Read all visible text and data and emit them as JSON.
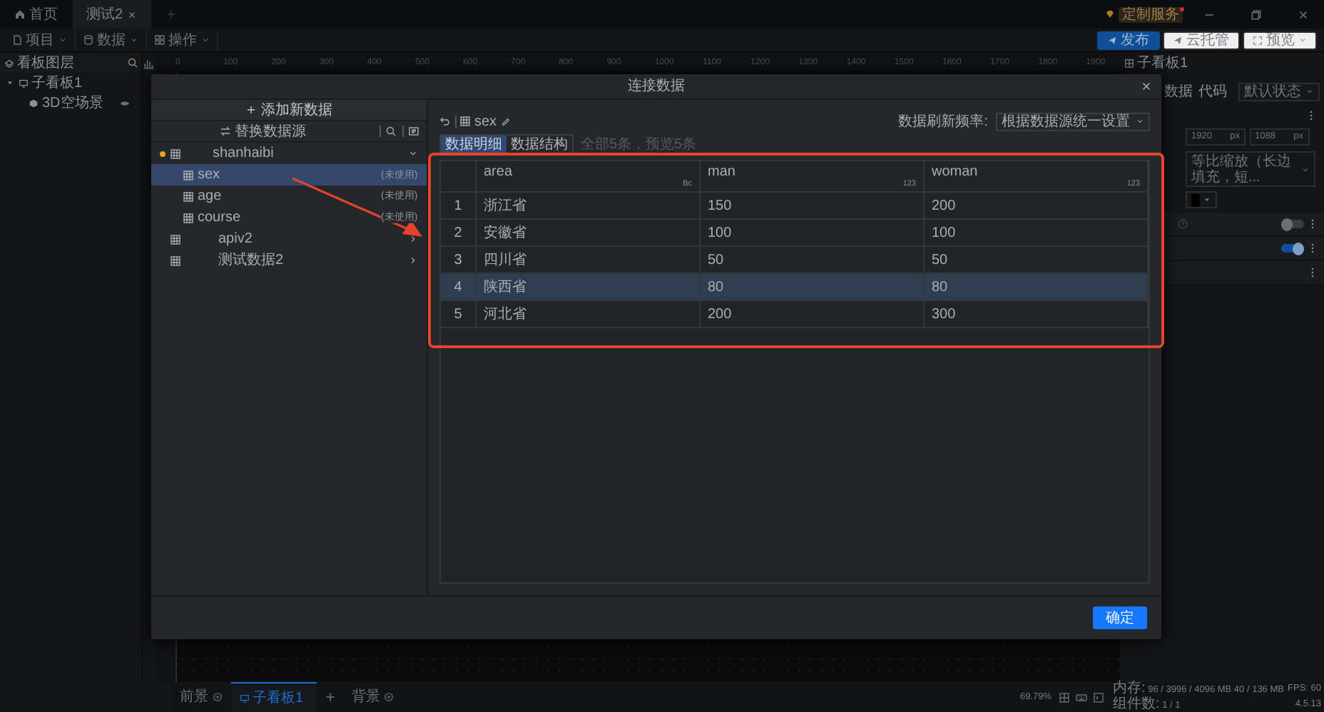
{
  "app_tabs": [
    {
      "label": "首页",
      "kind": "home",
      "selected": false,
      "closable": false
    },
    {
      "label": "测试2",
      "kind": "file",
      "selected": true,
      "closable": true
    }
  ],
  "service_badge": "定制服务",
  "menus": [
    {
      "label": "项目",
      "kind": "file"
    },
    {
      "label": "数据",
      "kind": "database"
    },
    {
      "label": "操作",
      "kind": "grid"
    }
  ],
  "actions": [
    {
      "label": "发布",
      "kind": "primary"
    },
    {
      "label": "云托管",
      "kind": "plain"
    },
    {
      "label": "预览",
      "kind": "dropdown"
    }
  ],
  "layers_panel": {
    "title": "看板图层",
    "tree": [
      {
        "label": "子看板1",
        "kind": "board",
        "expanded": true,
        "children": [
          {
            "label": "3D空场景",
            "kind": "scene",
            "visible": true
          }
        ]
      }
    ]
  },
  "ruler": [
    "0",
    "100",
    "200",
    "300",
    "400",
    "500",
    "600",
    "700",
    "800",
    "900",
    "1000",
    "1100",
    "1200",
    "1300",
    "1400",
    "1500",
    "1600",
    "1700",
    "1800",
    "1900"
  ],
  "right_panel": {
    "title": "子看板1",
    "tabs": [
      "数据",
      "代码"
    ],
    "state_select": "默认状态",
    "width": {
      "value": "1920",
      "unit": "px"
    },
    "height": {
      "value": "1088",
      "unit": "px"
    },
    "scale_mode": "等比缩放（长边填充，短...",
    "rows": [
      {
        "kind": "help-toggle",
        "on": false
      },
      {
        "kind": "toggle",
        "on": true
      },
      {
        "kind": "menu"
      }
    ]
  },
  "modal": {
    "title": "连接数据",
    "add_button": "添加新数据",
    "replace_button": "替换数据源",
    "sources": [
      {
        "name": "shanhaibi",
        "active": true,
        "expanded": true,
        "children": [
          {
            "name": "sex",
            "note": "(未使用)",
            "selected": true
          },
          {
            "name": "age",
            "note": "(未使用)",
            "selected": false
          },
          {
            "name": "course",
            "note": "(未使用)",
            "selected": false
          }
        ]
      },
      {
        "name": "apiv2",
        "active": false,
        "expanded": false
      },
      {
        "name": "测试数据2",
        "active": false,
        "expanded": false
      }
    ],
    "dataset": "sex",
    "refresh_label": "数据刷新频率:",
    "refresh_value": "根据数据源统一设置",
    "tabs": [
      {
        "label": "数据明细",
        "selected": true
      },
      {
        "label": "数据结构",
        "selected": false
      }
    ],
    "summary": "全部5条，预览5条",
    "table": {
      "columns": [
        {
          "name": "area",
          "type": "Bc"
        },
        {
          "name": "man",
          "type": "123"
        },
        {
          "name": "woman",
          "type": "123"
        }
      ],
      "rows": [
        {
          "index": "1",
          "cells": [
            "浙江省",
            "150",
            "200"
          ],
          "selected": false
        },
        {
          "index": "2",
          "cells": [
            "安徽省",
            "100",
            "100"
          ],
          "selected": false
        },
        {
          "index": "3",
          "cells": [
            "四川省",
            "50",
            "50"
          ],
          "selected": false
        },
        {
          "index": "4",
          "cells": [
            "陕西省",
            "80",
            "80"
          ],
          "selected": true
        },
        {
          "index": "5",
          "cells": [
            "河北省",
            "200",
            "300"
          ],
          "selected": false
        }
      ]
    },
    "confirm": "确定"
  },
  "bottom_bar": {
    "layers": [
      {
        "label": "前景",
        "kind": "add",
        "selected": false
      },
      {
        "label": "子看板1",
        "kind": "board",
        "selected": true
      },
      {
        "label": "背景",
        "kind": "add",
        "selected": false
      }
    ],
    "zoom": "69.79%",
    "memory_label": "内存:",
    "memory": "96 / 3996 / 4096 MB  40 / 136 MB",
    "fps": "FPS: 60",
    "count_label": "组件数:",
    "count": "1 / 1",
    "version": "4.5.13"
  }
}
